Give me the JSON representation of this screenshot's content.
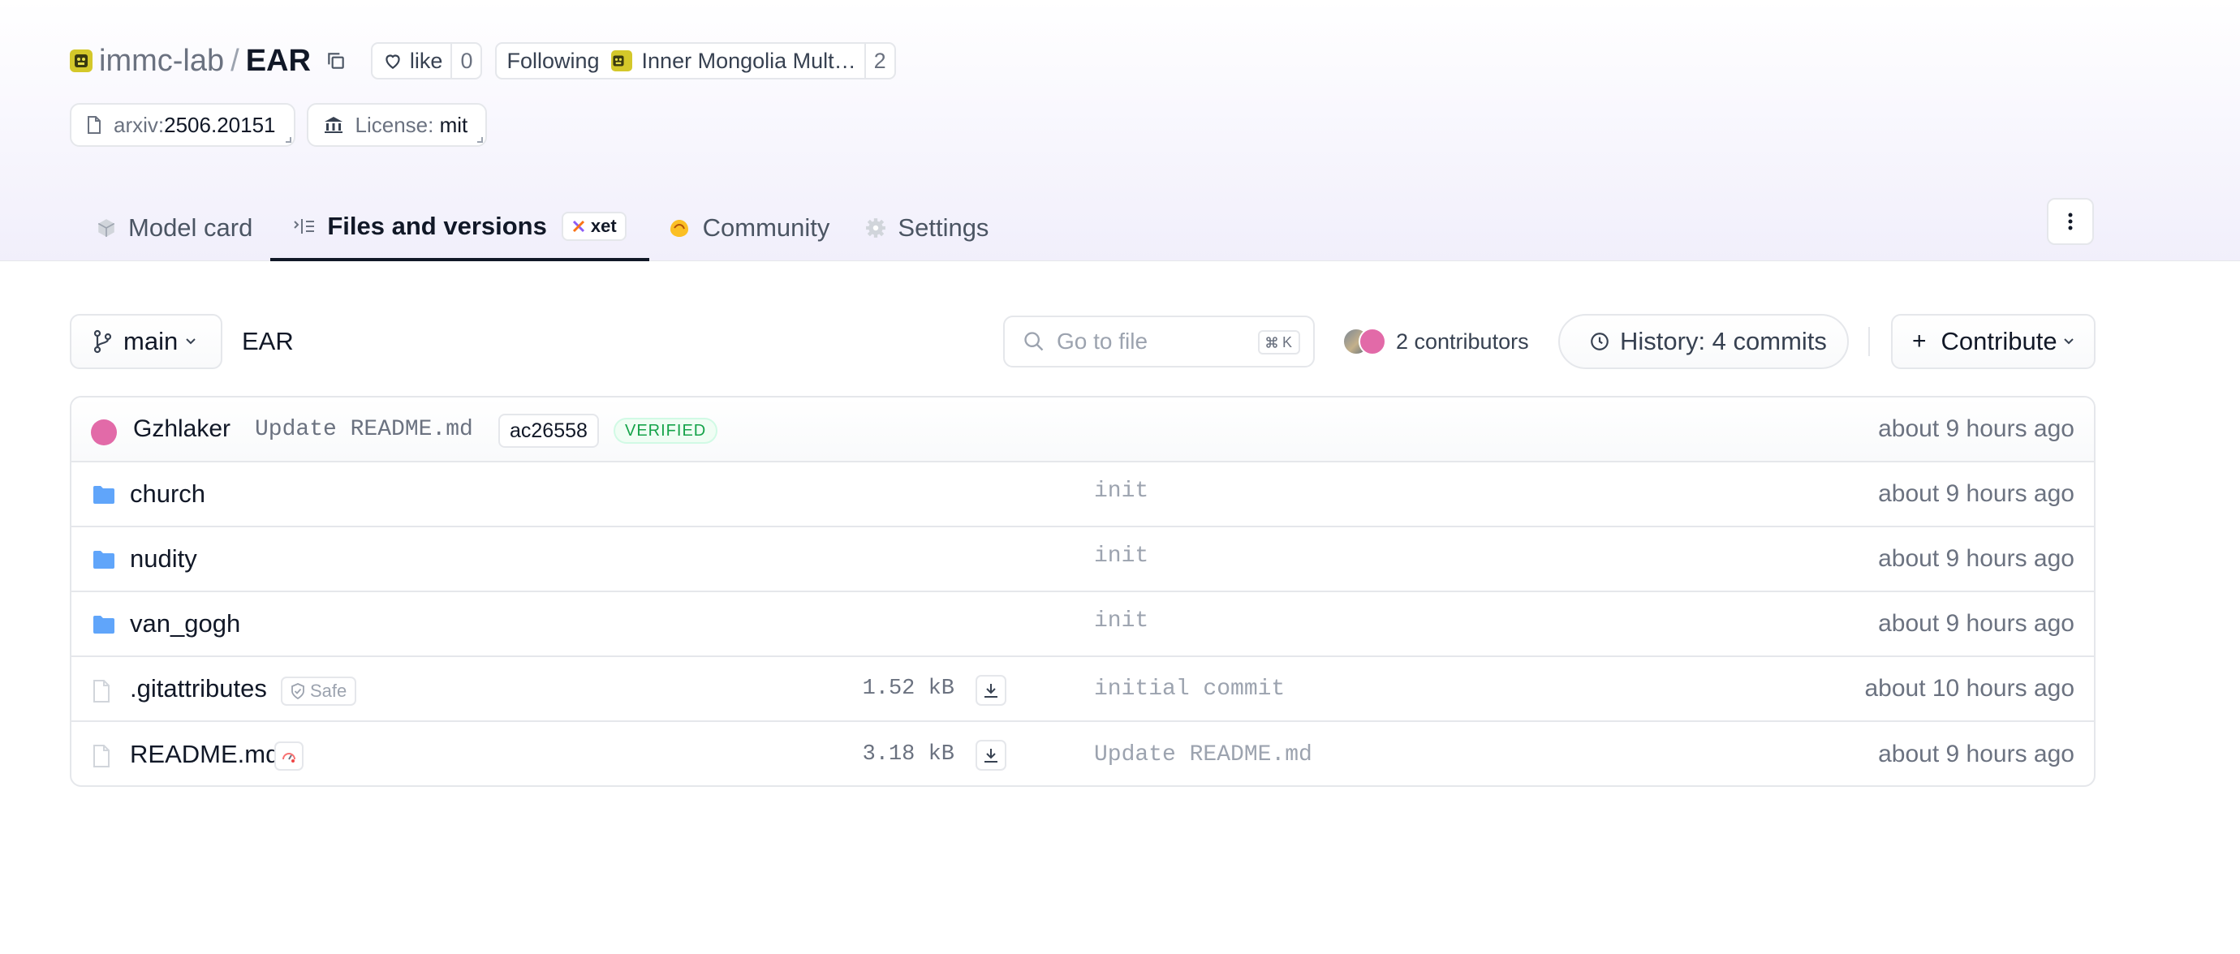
{
  "repo": {
    "org": "immc-lab",
    "separator": "/",
    "name": "EAR"
  },
  "like": {
    "label": "like",
    "count": "0"
  },
  "following": {
    "label": "Following",
    "org": "Inner Mongolia Mult…",
    "count": "2"
  },
  "tags": [
    {
      "key": "arxiv:",
      "value": "2506.20151"
    },
    {
      "key": "License:",
      "value": "mit"
    }
  ],
  "tabs": [
    {
      "label": "Model card"
    },
    {
      "label": "Files and versions",
      "badge": "xet"
    },
    {
      "label": "Community"
    },
    {
      "label": "Settings"
    }
  ],
  "toolbar": {
    "branch": "main",
    "breadcrumb": "EAR",
    "search_placeholder": "Go to file",
    "shortcut_key": "K",
    "contributors": "2 contributors",
    "history": "History: 4 commits",
    "contribute": "Contribute"
  },
  "last_commit": {
    "author": "Gzhlaker",
    "message": "Update README.md",
    "sha": "ac26558",
    "badge": "VERIFIED",
    "time": "about 9 hours ago"
  },
  "files": [
    {
      "type": "folder",
      "name": "church",
      "size": "",
      "commit": "init",
      "time": "about 9 hours ago"
    },
    {
      "type": "folder",
      "name": "nudity",
      "size": "",
      "commit": "init",
      "time": "about 9 hours ago"
    },
    {
      "type": "folder",
      "name": "van_gogh",
      "size": "",
      "commit": "init",
      "time": "about 9 hours ago"
    },
    {
      "type": "file",
      "name": ".gitattributes",
      "badge": "Safe",
      "size": "1.52 kB",
      "commit": "initial commit",
      "time": "about 10 hours ago"
    },
    {
      "type": "file",
      "name": "README.md",
      "size": "3.18 kB",
      "commit": "Update README.md",
      "time": "about 9 hours ago"
    }
  ],
  "colors": {
    "accent_dark": "#111827",
    "folder": "#60a5fa",
    "verified_green": "#16a34a",
    "commit_avatar": "#e26aa8",
    "org_avatar": "#d4c82a"
  }
}
